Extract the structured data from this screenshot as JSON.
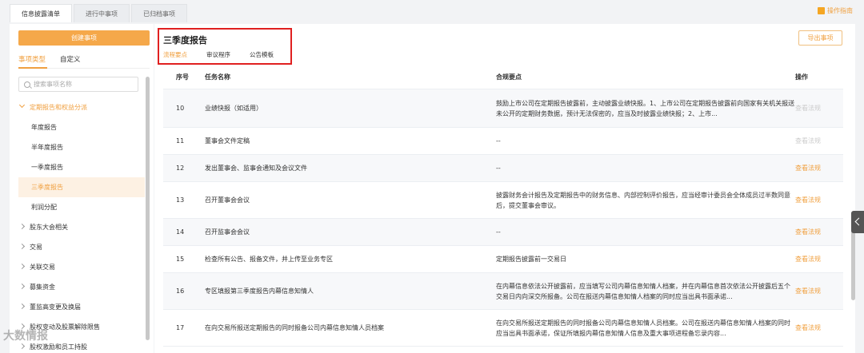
{
  "top_tabs": [
    "信息披露清单",
    "进行中事项",
    "已归档事项"
  ],
  "guide_label": "操作指南",
  "sidebar": {
    "create_label": "创建事项",
    "type_tabs": [
      "事项类型",
      "自定义"
    ],
    "search_placeholder": "搜索事项名称",
    "tree": [
      {
        "label": "定期报告和权益分派",
        "kind": "group",
        "open": true
      },
      {
        "label": "年度报告",
        "kind": "child"
      },
      {
        "label": "半年度报告",
        "kind": "child"
      },
      {
        "label": "一季度报告",
        "kind": "child"
      },
      {
        "label": "三季度报告",
        "kind": "child",
        "active": true
      },
      {
        "label": "利润分配",
        "kind": "child"
      },
      {
        "label": "股东大会相关",
        "kind": "group"
      },
      {
        "label": "交易",
        "kind": "group"
      },
      {
        "label": "关联交易",
        "kind": "group"
      },
      {
        "label": "募集资金",
        "kind": "group"
      },
      {
        "label": "董监高变更及换届",
        "kind": "group"
      },
      {
        "label": "股权变动及股票解除限售",
        "kind": "group"
      },
      {
        "label": "股权激励和员工持股",
        "kind": "group"
      }
    ]
  },
  "main": {
    "title": "三季度报告",
    "sub_tabs": [
      "流程要点",
      "审议程序",
      "公告模板"
    ],
    "export_label": "导出事项",
    "columns": [
      "序号",
      "任务名称",
      "合规要点",
      "操作"
    ],
    "rows": [
      {
        "no": "10",
        "name": "业绩快报（如适用）",
        "req": "鼓励上市公司在定期报告披露前，主动披露业绩快报。1、上市公司在定期报告披露前向国家有关机关报送未公开的定期财务数据，预计无法保密的，应当及时披露业绩快报；2、上市...",
        "op": "查看法规",
        "enabled": false
      },
      {
        "no": "11",
        "name": "董事会文件定稿",
        "req": "--",
        "op": "查看法规",
        "enabled": false
      },
      {
        "no": "12",
        "name": "发出董事会、监事会通知及会议文件",
        "req": "--",
        "op": "查看法规",
        "enabled": true
      },
      {
        "no": "13",
        "name": "召开董事会会议",
        "req": "披露财务会计报告及定期报告中的财务信息、内部控制评价报告，应当经审计委员会全体成员过半数同意后，提交董事会审议。",
        "op": "查看法规",
        "enabled": true
      },
      {
        "no": "14",
        "name": "召开监事会会议",
        "req": "--",
        "op": "查看法规",
        "enabled": true
      },
      {
        "no": "15",
        "name": "检查所有公告、报备文件，并上传至业务专区",
        "req": "定期报告披露前一交易日",
        "op": "查看法规",
        "enabled": true
      },
      {
        "no": "16",
        "name": "专区填报第三季度报告内幕信息知情人",
        "req": "在内幕信息依法公开披露前，应当填写公司内幕信息知情人档案，并在内幕信息首次依法公开披露后五个交易日内向深交所报备。公司在报送内幕信息知情人档案的同时应当出具书面承诺...",
        "op": "查看法规",
        "enabled": true
      },
      {
        "no": "17",
        "name": "在向交易所报送定期报告的同时报备公司内幕信息知情人员档案",
        "req": "在向交易所报送定期报告的同时报备公司内幕信息知情人员档案。公司在报送内幕信息知情人档案的同时应当出具书面承诺，保证所填报内幕信息知情人信息及重大事项进程备忘录内容...",
        "op": "查看法规",
        "enabled": true
      }
    ]
  },
  "watermark": "大数情报"
}
